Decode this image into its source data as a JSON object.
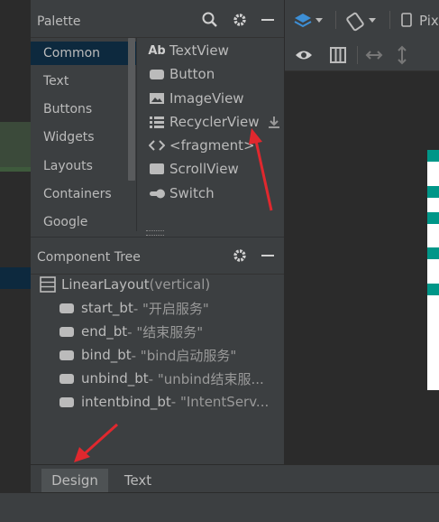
{
  "palette": {
    "title": "Palette",
    "categories": [
      {
        "label": "Common",
        "selected": true
      },
      {
        "label": "Text"
      },
      {
        "label": "Buttons"
      },
      {
        "label": "Widgets"
      },
      {
        "label": "Layouts"
      },
      {
        "label": "Containers"
      },
      {
        "label": "Google"
      }
    ],
    "widgets": [
      {
        "icon": "ab-icon",
        "label": "TextView"
      },
      {
        "icon": "button-icon",
        "label": "Button"
      },
      {
        "icon": "image-icon",
        "label": "ImageView"
      },
      {
        "icon": "list-icon",
        "label": "RecyclerView"
      },
      {
        "icon": "code-icon",
        "label": "<fragment>"
      },
      {
        "icon": "scroll-icon",
        "label": "ScrollView"
      },
      {
        "icon": "switch-icon",
        "label": "Switch"
      }
    ],
    "ab_text": "Ab"
  },
  "component_tree": {
    "title": "Component Tree",
    "root": {
      "name": "LinearLayout",
      "detail": "(vertical)"
    },
    "children": [
      {
        "id": "start_bt",
        "text": "- \"开启服务\""
      },
      {
        "id": "end_bt",
        "text": "- \"结束服务\""
      },
      {
        "id": "bind_bt",
        "text": "- \"bind启动服务\""
      },
      {
        "id": "unbind_bt",
        "text": "- \"unbind结束服..."
      },
      {
        "id": "intentbind_bt",
        "text": "- \"IntentServ..."
      }
    ]
  },
  "bottom_tabs": [
    {
      "label": "Design",
      "active": true
    },
    {
      "label": "Text"
    }
  ],
  "toolbar": {
    "device_text": "Pix"
  },
  "colors": {
    "accent_teal": "#009688",
    "arrow_red": "#e0282e",
    "selection_blue": "#0d293e",
    "design_icon_blue": "#3d8fd6"
  }
}
